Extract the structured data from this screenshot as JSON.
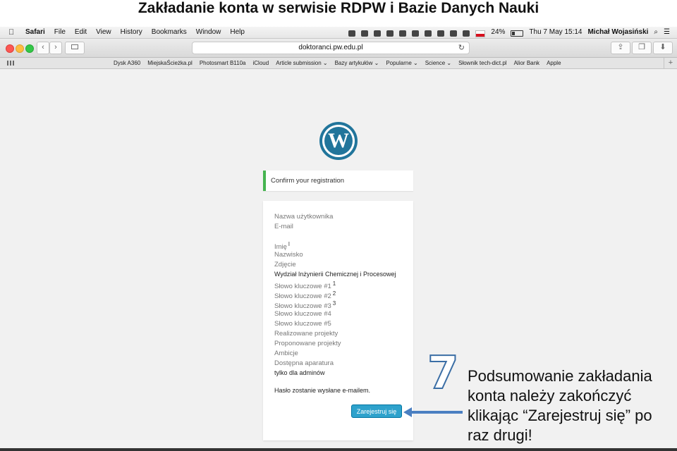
{
  "slide": {
    "title": "Zakładanie konta w serwisie RDPW i Bazie Danych Nauki",
    "step_number": "7",
    "caption": "Podsumowanie zakładania konta należy zakończyć klikając “Zarejestruj się” po raz drugi!"
  },
  "menubar": {
    "apple": "",
    "app": "Safari",
    "items": [
      "File",
      "Edit",
      "View",
      "History",
      "Bookmarks",
      "Window",
      "Help"
    ],
    "battery": "24%",
    "datetime": "Thu 7 May  15:14",
    "user": "Michał Wojasiński",
    "search_icon": "⌕",
    "list_icon": "☰"
  },
  "toolbar": {
    "back": "‹",
    "forward": "›",
    "url": "doktoranci.pw.edu.pl",
    "reload": "↻",
    "share": "⇪",
    "tabs": "❐",
    "download": "⬇"
  },
  "bookmarks": {
    "items": [
      "Dysk A360",
      "MiejskaŚcieżka.pl",
      "Photosmart B110a",
      "iCloud",
      "Article submission ⌄",
      "Bazy artykułów ⌄",
      "Popularne ⌄",
      "Science ⌄",
      "Słownik tech-dict.pl",
      "Alior Bank",
      "Apple"
    ],
    "plus": "+"
  },
  "page": {
    "logo_letter": "W",
    "notice": "Confirm your registration",
    "fields": [
      {
        "label": "Nazwa użytkownika",
        "sup": ""
      },
      {
        "label": "E-mail",
        "sup": ""
      },
      {
        "label": "Imię",
        "sup": "l"
      },
      {
        "label": "Nazwisko",
        "sup": ""
      },
      {
        "label": "Zdjęcie",
        "sup": ""
      },
      {
        "label": "Wydział Inżynierii Chemicznej i Procesowej",
        "sup": ""
      },
      {
        "label": "Słowo kluczowe #1",
        "sup": "1"
      },
      {
        "label": "Słowo kluczowe #2",
        "sup": "2"
      },
      {
        "label": "Słowo kluczowe #3",
        "sup": "3"
      },
      {
        "label": "Słowo kluczowe #4",
        "sup": ""
      },
      {
        "label": "Słowo kluczowe #5",
        "sup": ""
      },
      {
        "label": "Realizowane projekty",
        "sup": ""
      },
      {
        "label": "Proponowane projekty",
        "sup": ""
      },
      {
        "label": "Ambicje",
        "sup": ""
      },
      {
        "label": "Dostępna aparatura",
        "sup": ""
      },
      {
        "label": "tylko dla adminów",
        "sup": ""
      }
    ],
    "password_note": "Hasło zostanie wysłane e-mailem.",
    "submit": "Zarejestruj się"
  },
  "colors": {
    "wp_blue": "#21759b",
    "notice_green": "#46b450",
    "button_blue": "#2ea2cc",
    "arrow_blue": "#4a7fc1"
  }
}
